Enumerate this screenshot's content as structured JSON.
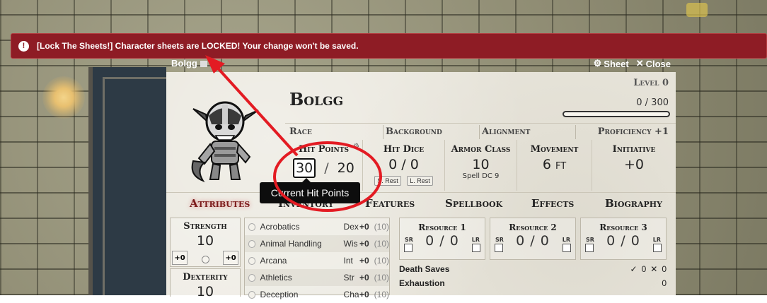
{
  "banner": {
    "text": "[Lock The Sheets!] Character sheets are LOCKED! Your change won't be saved."
  },
  "window": {
    "title": "Bolgg",
    "sheet_label": "Sheet",
    "close_label": "Close"
  },
  "character": {
    "name": "Bolgg",
    "level": "Level 0",
    "xp": "0 / 300"
  },
  "info": {
    "race": "Race",
    "background": "Background",
    "alignment": "Alignment",
    "proficiency": "Proficiency +1"
  },
  "stats": {
    "hp_label": "Hit Points",
    "hp_current": "30",
    "hp_sep": "/",
    "hp_max": "20",
    "hit_dice_label": "Hit Dice",
    "hit_dice": "0 / 0",
    "short_rest": "S. Rest",
    "long_rest": "L. Rest",
    "ac_label": "Armor Class",
    "ac": "10",
    "spell_dc": "Spell DC 9",
    "movement_label": "Movement",
    "movement": "6 ft",
    "initiative_label": "Initiative",
    "initiative": "+0"
  },
  "tooltip": {
    "text": "Current Hit Points"
  },
  "tabs": [
    "Attributes",
    "Inventory",
    "Features",
    "Spellbook",
    "Effects",
    "Biography"
  ],
  "attributes": [
    {
      "name": "Strength",
      "value": "10",
      "mod": "+0",
      "save": "+0"
    },
    {
      "name": "Dexterity",
      "value": "10"
    }
  ],
  "skills": [
    {
      "name": "Acrobatics",
      "ability": "Dex",
      "mod": "+0",
      "passive": "(10)"
    },
    {
      "name": "Animal Handling",
      "ability": "Wis",
      "mod": "+0",
      "passive": "(10)"
    },
    {
      "name": "Arcana",
      "ability": "Int",
      "mod": "+0",
      "passive": "(10)"
    },
    {
      "name": "Athletics",
      "ability": "Str",
      "mod": "+0",
      "passive": "(10)"
    },
    {
      "name": "Deception",
      "ability": "Cha",
      "mod": "+0",
      "passive": "(10)"
    }
  ],
  "resources": [
    {
      "label": "Resource 1",
      "value": "0 / 0",
      "sr": "SR",
      "lr": "LR"
    },
    {
      "label": "Resource 2",
      "value": "0 / 0",
      "sr": "SR",
      "lr": "LR"
    },
    {
      "label": "Resource 3",
      "value": "0 / 0",
      "sr": "SR",
      "lr": "LR"
    }
  ],
  "death_saves": {
    "label": "Death Saves",
    "success_icon": "check-icon",
    "success": "0",
    "failure_icon": "x-icon",
    "failure": "0"
  },
  "exhaustion": {
    "label": "Exhaustion",
    "value": "0"
  },
  "colors": {
    "banner": "#8e1c25",
    "annotation": "#e31b23",
    "tab_active": "#7a1a1a"
  }
}
